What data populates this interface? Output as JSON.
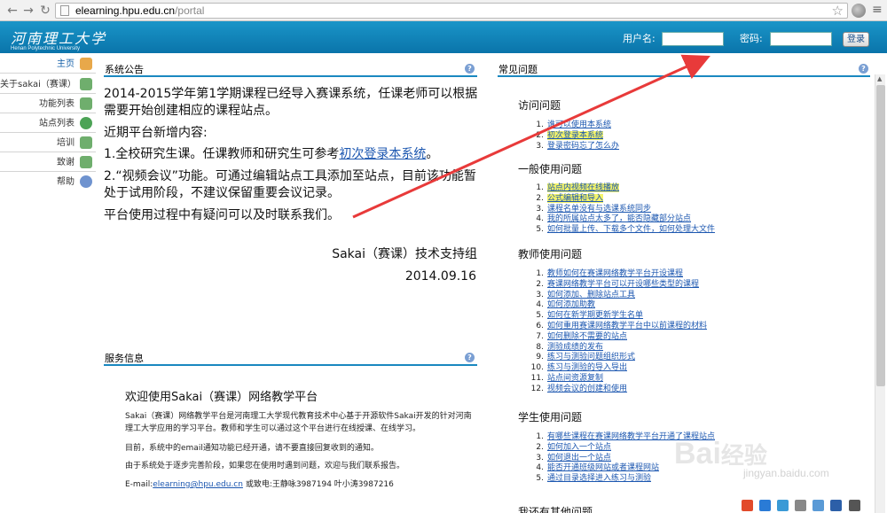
{
  "browser": {
    "url_host": "elearning.hpu.edu.cn",
    "url_path": "/portal"
  },
  "header": {
    "logo_cn": "河南理工大学",
    "logo_en": "Henan Polytechnic University",
    "username_label": "用户名:",
    "password_label": "密码:",
    "login_button": "登录"
  },
  "sidebar": {
    "items": [
      {
        "label": "主页",
        "icon": "home-icon",
        "color": "#d98c2b"
      },
      {
        "label": "关于sakai（赛课）",
        "icon": "page-icon",
        "color": "#5fa85d"
      },
      {
        "label": "功能列表",
        "icon": "page-icon",
        "color": "#5fa85d"
      },
      {
        "label": "站点列表",
        "icon": "globe-icon",
        "color": "#4ca356"
      },
      {
        "label": "培训",
        "icon": "page-icon",
        "color": "#5fa85d"
      },
      {
        "label": "致谢",
        "icon": "page-icon",
        "color": "#5fa85d"
      },
      {
        "label": "帮助",
        "icon": "help-icon",
        "color": "#6f93cf"
      }
    ]
  },
  "announcement": {
    "title": "系统公告",
    "line1": "2014-2015学年第1学期课程已经导入赛课系统，任课老师可以根据",
    "line2": "需要开始创建相应的课程站点。",
    "line3": "近期平台新增内容:",
    "line4_prefix": "1.全校研究生课。任课教师和研究生可参考",
    "line4_link": "初次登录本系统",
    "line4_suffix": "。",
    "line5": "2.“视频会议”功能。可通过编辑站点工具添加至站点，目前该功能暂",
    "line6": "处于试用阶段，不建议保留重要会议记录。",
    "line7": "平台使用过程中有疑问可以及时联系我们。",
    "signature": "Sakai（赛课）技术支持组",
    "date": "2014.09.16"
  },
  "service": {
    "title": "服务信息",
    "welcome": "欢迎使用Sakai（赛课）网络教学平台",
    "p1a": "Sakai（赛课）网络教学平台是河南理工大学现代教育技术中心基于开源软件Sakai开发的针对河南",
    "p1b": "理工大学应用的学习平台。教师和学生可以通过这个平台进行在线授课、在线学习。",
    "p2": "目前，系统中的email通知功能已经开通，请不要直接回复收到的通知。",
    "p3": "由于系统处于逐步完善阶段，如果您在使用时遇到问题，欢迎与我们联系报告。",
    "email_prefix": "E-mail:",
    "email": "elearning@hpu.edu.cn",
    "phone": " 或致电:王静咏3987194 叶小涛3987216"
  },
  "faq": {
    "title": "常见问题",
    "sections": [
      {
        "heading": "访问问题",
        "items": [
          {
            "text": "谁可以使用本系统",
            "highlight": false
          },
          {
            "text": "初次登录本系统",
            "highlight": true
          },
          {
            "text": "登录密码忘了怎么办",
            "highlight": false
          }
        ]
      },
      {
        "heading": "一般使用问题",
        "items": [
          {
            "text": "站点内视频在线播放",
            "highlight": true
          },
          {
            "text": "公式编辑和导入",
            "highlight": true
          },
          {
            "text": "课程名单没有与选课系统同步",
            "highlight": false
          },
          {
            "text": "我的所属站点太多了，能否隐藏部分站点",
            "highlight": false
          },
          {
            "text": "如何批量上传、下载多个文件，如何处理大文件",
            "highlight": false
          }
        ]
      },
      {
        "heading": "教师使用问题",
        "items": [
          {
            "text": "教师如何在赛课网络教学平台开设课程",
            "highlight": false
          },
          {
            "text": "赛课网络教学平台可以开设哪些类型的课程",
            "highlight": false
          },
          {
            "text": "如何添加、删除站点工具",
            "highlight": false
          },
          {
            "text": "如何添加助教",
            "highlight": false
          },
          {
            "text": "如何在新学期更新学生名单",
            "highlight": false
          },
          {
            "text": "如何重用赛课网络教学平台中以前课程的材料",
            "highlight": false
          },
          {
            "text": "如何删除不需要的站点",
            "highlight": false
          },
          {
            "text": "测验成绩的发布",
            "highlight": false
          },
          {
            "text": "练习与测验问题组织形式",
            "highlight": false
          },
          {
            "text": "练习与测验的导入导出",
            "highlight": false
          },
          {
            "text": "站点间资源复制",
            "highlight": false
          },
          {
            "text": "视频会议的创建和使用",
            "highlight": false
          }
        ]
      },
      {
        "heading": "学生使用问题",
        "items": [
          {
            "text": "有哪些课程在赛课网络教学平台开通了课程站点",
            "highlight": false
          },
          {
            "text": "如何加入一个站点",
            "highlight": false
          },
          {
            "text": "如何退出一个站点",
            "highlight": false
          },
          {
            "text": "能否开通班级网站或者课程网站",
            "highlight": false
          },
          {
            "text": "通过目录选择进入练习与测验",
            "highlight": false
          }
        ]
      },
      {
        "heading": "我还有其他问题",
        "items": []
      }
    ]
  },
  "watermark": {
    "brand": "Bai",
    "brand_cn": "经验",
    "sub": "jingyan.baidu.com"
  },
  "colors": {
    "header_blue": "#0a74aa",
    "link_blue": "#1c57b0",
    "highlight_yellow": "#f3f36a",
    "arrow_red": "#e83a3a"
  }
}
